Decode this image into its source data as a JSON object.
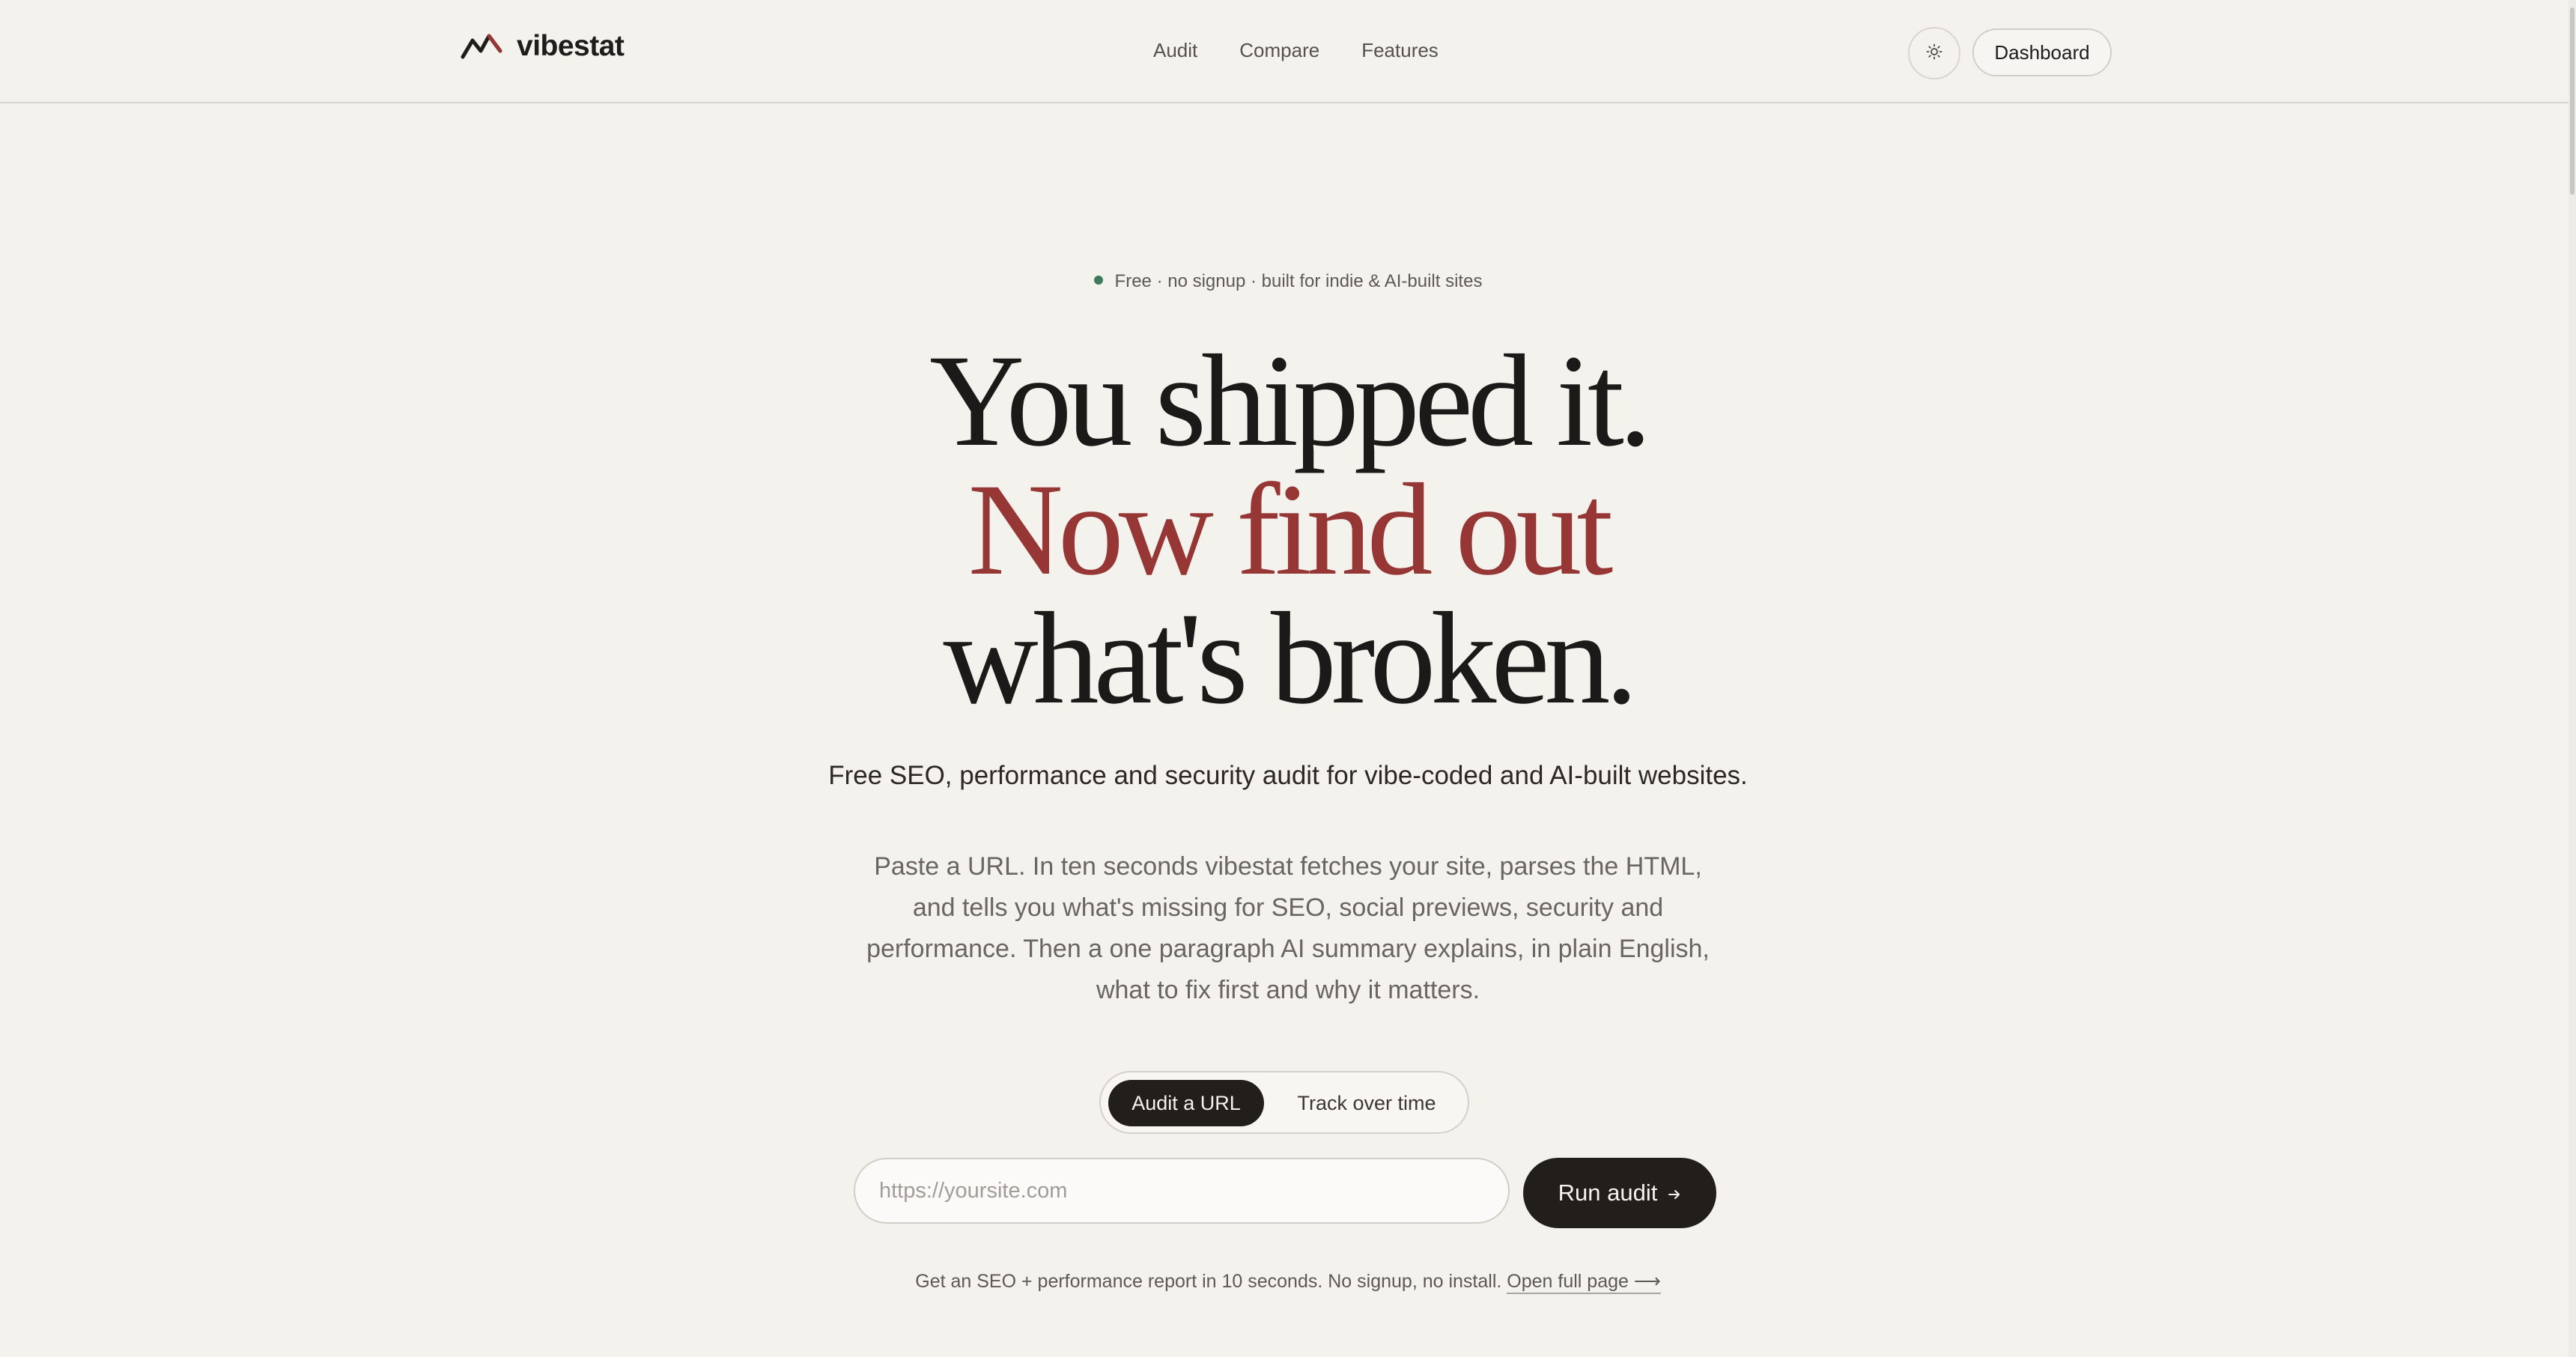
{
  "header": {
    "brand": "vibestat",
    "nav": [
      "Audit",
      "Compare",
      "Features"
    ],
    "theme_icon": "sun-icon",
    "dashboard_label": "Dashboard"
  },
  "hero": {
    "pill_text": "Free · no signup · built for indie & AI-built sites",
    "headline_line1": "You shipped it.",
    "headline_line2": "Now find out",
    "headline_line3": "what's broken.",
    "subhead": "Free SEO, performance and security audit for vibe-coded and AI-built websites.",
    "description": "Paste a URL. In ten seconds vibestat fetches your site, parses the HTML, and tells you what's missing for SEO, social previews, security and performance. Then a one paragraph AI summary explains, in plain English, what to fix first and why it matters."
  },
  "audit_form": {
    "tabs": [
      "Audit a URL",
      "Track over time"
    ],
    "active_tab": "Audit a URL",
    "url_placeholder": "https://yoursite.com",
    "url_value": "",
    "run_label": "Run audit",
    "run_icon": "arrow-right-icon"
  },
  "footnote": {
    "text": "Get an SEO + performance report in 10 seconds. No signup, no install.",
    "link_label": "Open full page ⟶"
  },
  "colors": {
    "background": "#f4f2ed",
    "accent": "#963736",
    "dark": "#211e1c",
    "dot_green": "#3f7a5a"
  }
}
